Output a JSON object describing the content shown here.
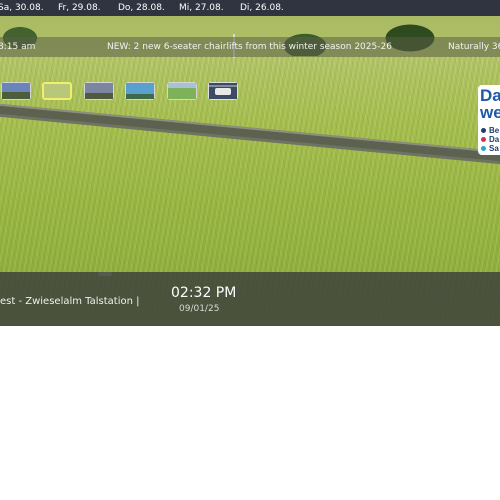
{
  "date_bar": {
    "days": [
      "Sa, 30.08.",
      "Fr, 29.08.",
      "Do, 28.08.",
      "Mi, 27.08.",
      "Di, 26.08."
    ]
  },
  "ticker": {
    "left": "8:15 am",
    "message": "NEW: 2 new 6-seater chairlifts from this winter season 2025-26",
    "right": "Naturally 36"
  },
  "thumbnails": [
    {
      "name": "thumb-1",
      "active": false,
      "color": "#6a86b8"
    },
    {
      "name": "thumb-2",
      "active": true,
      "color": "#b9c77a"
    },
    {
      "name": "thumb-3",
      "active": false,
      "color": "#7d86a0"
    },
    {
      "name": "thumb-4",
      "active": false,
      "color": "#5aa0cf"
    },
    {
      "name": "thumb-5",
      "active": false,
      "color": "#7fb05a"
    },
    {
      "name": "thumb-6",
      "active": false,
      "color": "#3d4a66"
    }
  ],
  "brand_logo": {
    "line1": "Da",
    "line2": "we",
    "items": [
      {
        "text": "Be",
        "color": "#1e3f6e"
      },
      {
        "text": "Da",
        "color": "#d0344a"
      },
      {
        "text": "Sa",
        "color": "#2aa3c9"
      }
    ]
  },
  "info_bar": {
    "location": "est - Zwieselalm Talstation |",
    "time": "02:32 PM",
    "date": "09/01/25"
  },
  "colors": {
    "date_bar_bg": "#2f3440",
    "info_bar_bg": "#41463c",
    "active_thumb_border": "#f1f06a",
    "brand_blue": "#1e5aa8"
  }
}
